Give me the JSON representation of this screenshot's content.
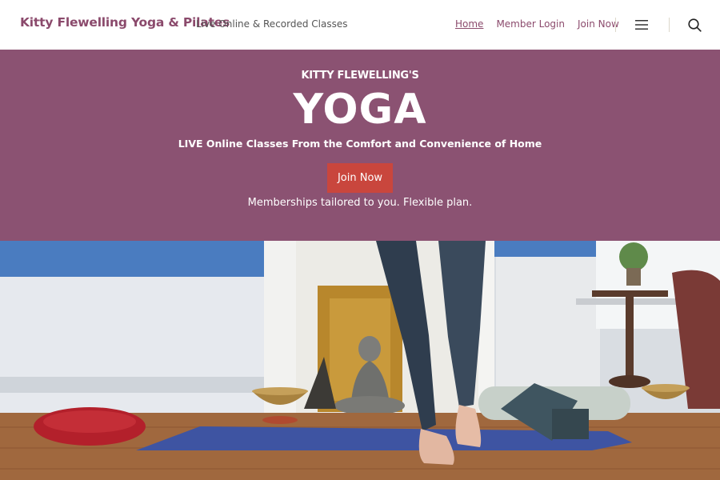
{
  "header": {
    "site_title": "Kitty Flewelling Yoga & Pilates",
    "tagline": "Live Online & Recorded Classes",
    "nav": [
      {
        "label": "Home",
        "current": true
      },
      {
        "label": "Member Login",
        "current": false
      },
      {
        "label": "Join Now",
        "current": false
      }
    ],
    "icons": {
      "menu": "hamburger-menu-icon",
      "search": "search-icon"
    }
  },
  "hero": {
    "kicker": "KITTY FLEWELLING'S",
    "title": "YOGA",
    "subtitle": "LIVE Online Classes From the Comfort and Convenience of Home",
    "button_label": "Join Now",
    "note": "Memberships tailored to you. Flexible plan."
  },
  "colors": {
    "accent": "#8b4a6c",
    "hero_background": "#8b5272",
    "button": "#c9463d"
  }
}
